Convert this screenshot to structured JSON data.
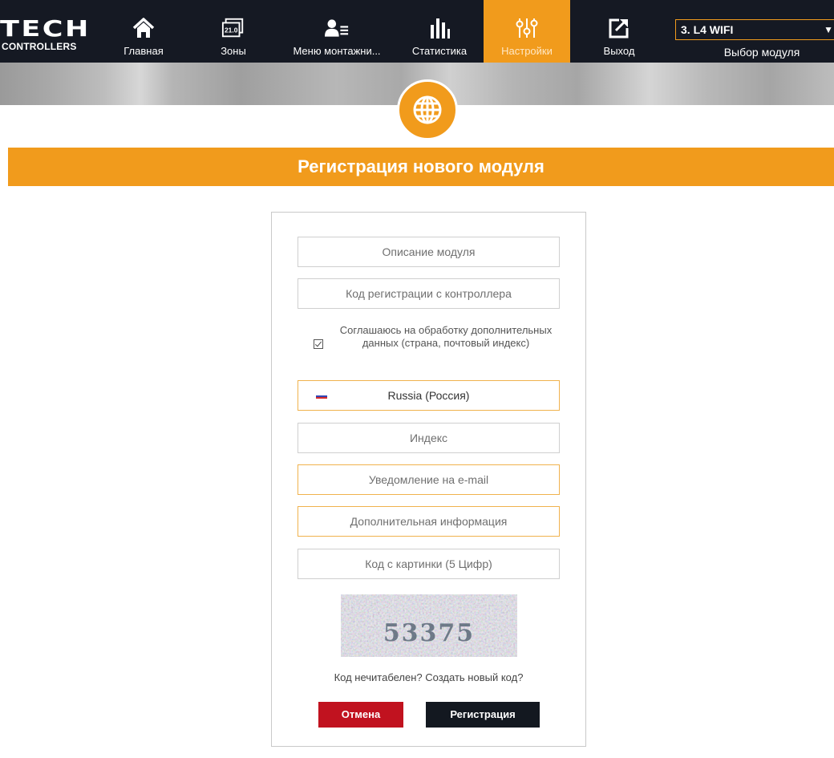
{
  "brand": {
    "name_big": "TECH",
    "name_small": "CONTROLLERS"
  },
  "nav": {
    "items": [
      {
        "label": "Главная",
        "icon": "home-icon"
      },
      {
        "label": "Зоны",
        "icon": "zones-icon",
        "badge": "21.0"
      },
      {
        "label": "Меню монтажни...",
        "icon": "installer-menu-icon"
      },
      {
        "label": "Статистика",
        "icon": "statistics-icon"
      },
      {
        "label": "Настройки",
        "icon": "settings-sliders-icon",
        "active": true
      },
      {
        "label": "Выход",
        "icon": "logout-icon"
      }
    ],
    "module_selected": "3. L4 WIFI",
    "module_label": "Выбор модуля"
  },
  "header": {
    "badge_icon": "globe-icon",
    "title": "Регистрация нового модуля"
  },
  "form": {
    "module_description_placeholder": "Описание модуля",
    "registration_code_placeholder": "Код регистрации с контроллера",
    "consent_label": "Соглашаюсь на обработку дополнительных данных (страна, почтовый индекс)",
    "consent_checked": true,
    "country_value": "Russia (Россия)",
    "postal_code_placeholder": "Индекс",
    "email_notification_placeholder": "Уведомление на e-mail",
    "additional_info_placeholder": "Дополнительная информация",
    "captcha_placeholder": "Код с картинки (5 Цифр)",
    "captcha_text": "53375",
    "regen_prefix": "Код нечитабелен?",
    "regen_link": "Создать новый код?",
    "cancel_label": "Отмена",
    "register_label": "Регистрация"
  },
  "colors": {
    "accent": "#f19b1c",
    "nav_bg": "#151923",
    "cancel": "#c1121f",
    "register": "#131820"
  }
}
